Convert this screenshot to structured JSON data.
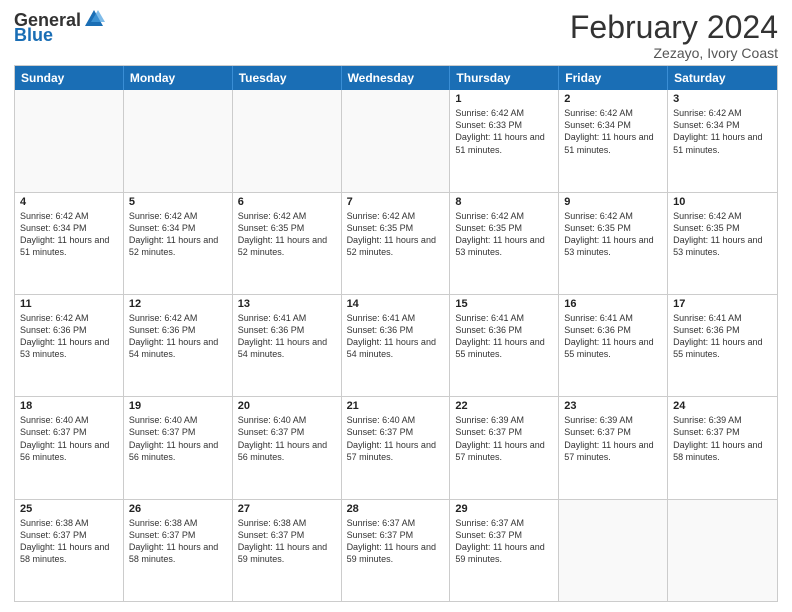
{
  "header": {
    "logo_general": "General",
    "logo_blue": "Blue",
    "month": "February 2024",
    "location": "Zezayo, Ivory Coast"
  },
  "days_of_week": [
    "Sunday",
    "Monday",
    "Tuesday",
    "Wednesday",
    "Thursday",
    "Friday",
    "Saturday"
  ],
  "weeks": [
    [
      {
        "day": "",
        "text": ""
      },
      {
        "day": "",
        "text": ""
      },
      {
        "day": "",
        "text": ""
      },
      {
        "day": "",
        "text": ""
      },
      {
        "day": "1",
        "text": "Sunrise: 6:42 AM\nSunset: 6:33 PM\nDaylight: 11 hours and 51 minutes."
      },
      {
        "day": "2",
        "text": "Sunrise: 6:42 AM\nSunset: 6:34 PM\nDaylight: 11 hours and 51 minutes."
      },
      {
        "day": "3",
        "text": "Sunrise: 6:42 AM\nSunset: 6:34 PM\nDaylight: 11 hours and 51 minutes."
      }
    ],
    [
      {
        "day": "4",
        "text": "Sunrise: 6:42 AM\nSunset: 6:34 PM\nDaylight: 11 hours and 51 minutes."
      },
      {
        "day": "5",
        "text": "Sunrise: 6:42 AM\nSunset: 6:34 PM\nDaylight: 11 hours and 52 minutes."
      },
      {
        "day": "6",
        "text": "Sunrise: 6:42 AM\nSunset: 6:35 PM\nDaylight: 11 hours and 52 minutes."
      },
      {
        "day": "7",
        "text": "Sunrise: 6:42 AM\nSunset: 6:35 PM\nDaylight: 11 hours and 52 minutes."
      },
      {
        "day": "8",
        "text": "Sunrise: 6:42 AM\nSunset: 6:35 PM\nDaylight: 11 hours and 53 minutes."
      },
      {
        "day": "9",
        "text": "Sunrise: 6:42 AM\nSunset: 6:35 PM\nDaylight: 11 hours and 53 minutes."
      },
      {
        "day": "10",
        "text": "Sunrise: 6:42 AM\nSunset: 6:35 PM\nDaylight: 11 hours and 53 minutes."
      }
    ],
    [
      {
        "day": "11",
        "text": "Sunrise: 6:42 AM\nSunset: 6:36 PM\nDaylight: 11 hours and 53 minutes."
      },
      {
        "day": "12",
        "text": "Sunrise: 6:42 AM\nSunset: 6:36 PM\nDaylight: 11 hours and 54 minutes."
      },
      {
        "day": "13",
        "text": "Sunrise: 6:41 AM\nSunset: 6:36 PM\nDaylight: 11 hours and 54 minutes."
      },
      {
        "day": "14",
        "text": "Sunrise: 6:41 AM\nSunset: 6:36 PM\nDaylight: 11 hours and 54 minutes."
      },
      {
        "day": "15",
        "text": "Sunrise: 6:41 AM\nSunset: 6:36 PM\nDaylight: 11 hours and 55 minutes."
      },
      {
        "day": "16",
        "text": "Sunrise: 6:41 AM\nSunset: 6:36 PM\nDaylight: 11 hours and 55 minutes."
      },
      {
        "day": "17",
        "text": "Sunrise: 6:41 AM\nSunset: 6:36 PM\nDaylight: 11 hours and 55 minutes."
      }
    ],
    [
      {
        "day": "18",
        "text": "Sunrise: 6:40 AM\nSunset: 6:37 PM\nDaylight: 11 hours and 56 minutes."
      },
      {
        "day": "19",
        "text": "Sunrise: 6:40 AM\nSunset: 6:37 PM\nDaylight: 11 hours and 56 minutes."
      },
      {
        "day": "20",
        "text": "Sunrise: 6:40 AM\nSunset: 6:37 PM\nDaylight: 11 hours and 56 minutes."
      },
      {
        "day": "21",
        "text": "Sunrise: 6:40 AM\nSunset: 6:37 PM\nDaylight: 11 hours and 57 minutes."
      },
      {
        "day": "22",
        "text": "Sunrise: 6:39 AM\nSunset: 6:37 PM\nDaylight: 11 hours and 57 minutes."
      },
      {
        "day": "23",
        "text": "Sunrise: 6:39 AM\nSunset: 6:37 PM\nDaylight: 11 hours and 57 minutes."
      },
      {
        "day": "24",
        "text": "Sunrise: 6:39 AM\nSunset: 6:37 PM\nDaylight: 11 hours and 58 minutes."
      }
    ],
    [
      {
        "day": "25",
        "text": "Sunrise: 6:38 AM\nSunset: 6:37 PM\nDaylight: 11 hours and 58 minutes."
      },
      {
        "day": "26",
        "text": "Sunrise: 6:38 AM\nSunset: 6:37 PM\nDaylight: 11 hours and 58 minutes."
      },
      {
        "day": "27",
        "text": "Sunrise: 6:38 AM\nSunset: 6:37 PM\nDaylight: 11 hours and 59 minutes."
      },
      {
        "day": "28",
        "text": "Sunrise: 6:37 AM\nSunset: 6:37 PM\nDaylight: 11 hours and 59 minutes."
      },
      {
        "day": "29",
        "text": "Sunrise: 6:37 AM\nSunset: 6:37 PM\nDaylight: 11 hours and 59 minutes."
      },
      {
        "day": "",
        "text": ""
      },
      {
        "day": "",
        "text": ""
      }
    ]
  ]
}
